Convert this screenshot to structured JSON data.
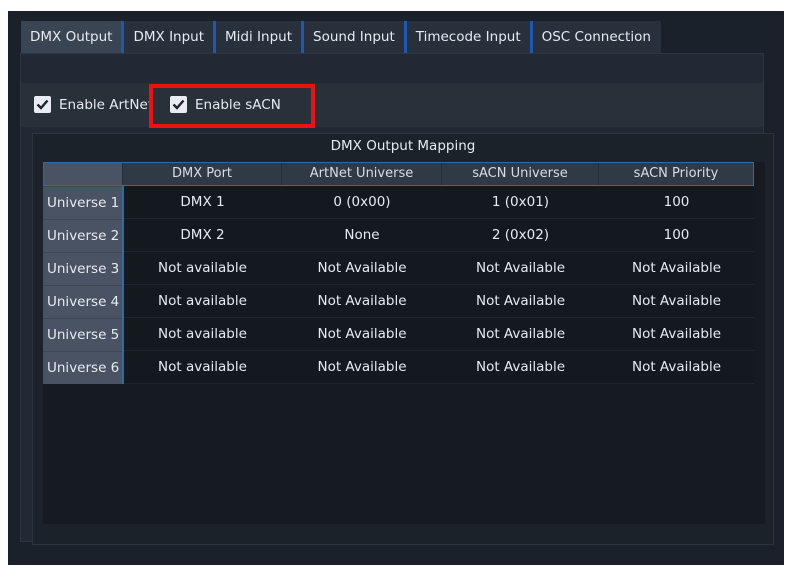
{
  "tabs": [
    {
      "label": "DMX Output",
      "active": true
    },
    {
      "label": "DMX Input",
      "active": false
    },
    {
      "label": "Midi Input",
      "active": false
    },
    {
      "label": "Sound Input",
      "active": false
    },
    {
      "label": "Timecode Input",
      "active": false
    },
    {
      "label": "OSC Connection",
      "active": false
    }
  ],
  "options": {
    "artnet_label": "Enable ArtNet",
    "artnet_checked": true,
    "sacn_label": "Enable sACN",
    "sacn_checked": true
  },
  "mapping": {
    "title": "DMX Output Mapping",
    "columns": [
      "DMX Port",
      "ArtNet Universe",
      "sACN Universe",
      "sACN Priority"
    ],
    "rows": [
      {
        "label": "Universe 1",
        "cells": [
          "DMX 1",
          "0 (0x00)",
          "1 (0x01)",
          "100"
        ]
      },
      {
        "label": "Universe 2",
        "cells": [
          "DMX 2",
          "None",
          "2 (0x02)",
          "100"
        ]
      },
      {
        "label": "Universe 3",
        "cells": [
          "Not available",
          "Not Available",
          "Not Available",
          "Not Available"
        ]
      },
      {
        "label": "Universe 4",
        "cells": [
          "Not available",
          "Not Available",
          "Not Available",
          "Not Available"
        ]
      },
      {
        "label": "Universe 5",
        "cells": [
          "Not available",
          "Not Available",
          "Not Available",
          "Not Available"
        ]
      },
      {
        "label": "Universe 6",
        "cells": [
          "Not available",
          "Not Available",
          "Not Available",
          "Not Available"
        ]
      }
    ]
  },
  "colors": {
    "tab_accent": "#1f58b3",
    "highlight": "#ee1111"
  }
}
